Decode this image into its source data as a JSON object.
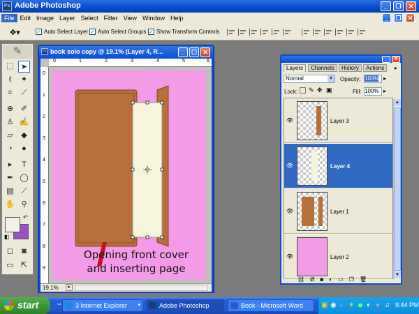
{
  "app": {
    "title": "Adobe Photoshop",
    "logo_text": "Ps",
    "window_controls": [
      "minimize-icon",
      "restore-icon",
      "close-icon"
    ]
  },
  "menu": [
    "File",
    "Edit",
    "Image",
    "Layer",
    "Select",
    "Filter",
    "View",
    "Window",
    "Help"
  ],
  "options": {
    "tool_icon": "move-tool-icon",
    "auto_select_layer": "Auto Select Layer",
    "auto_select_groups": "Auto Select Groups",
    "show_transform_controls": "Show Transform Controls"
  },
  "document": {
    "title": "book solo copy @ 19.1% (Layer 4, R...",
    "zoom": "19.1%",
    "canvas_text_line1": "Opening front cover",
    "canvas_text_line2": "and inserting page",
    "ruler_h": [
      "0",
      "1",
      "2",
      "3",
      "4",
      "5",
      "6"
    ],
    "ruler_v": [
      "0",
      "1",
      "2",
      "3",
      "4",
      "5",
      "6",
      "7",
      "8",
      "9"
    ]
  },
  "layers_panel": {
    "tabs": [
      "Layers",
      "Channels",
      "History",
      "Actions"
    ],
    "blend_mode": "Normal",
    "opacity_label": "Opacity:",
    "opacity_value": "100%",
    "lock_label": "Lock:",
    "fill_label": "Fill:",
    "fill_value": "100%",
    "layers": [
      {
        "name": "Layer 3",
        "selected": false
      },
      {
        "name": "Layer 4",
        "selected": true
      },
      {
        "name": "Layer 1",
        "selected": false
      },
      {
        "name": "Layer 2",
        "selected": false
      }
    ]
  },
  "taskbar": {
    "start": "start",
    "items": [
      {
        "label": "3 Internet Explorer",
        "active": false,
        "color": "#1e88e5"
      },
      {
        "label": "Adobe Photoshop",
        "active": true,
        "color": "#1c3c7c"
      },
      {
        "label": "Book - Microsoft Word",
        "active": false,
        "color": "#2b5fbf"
      }
    ],
    "clock": "9:44 PM"
  },
  "colors": {
    "canvas_background": "#f49be8",
    "book_cover": "#b86f3a",
    "inserted_page": "#f5f5dc",
    "selection_blue": "#316ac5",
    "foreground_swatch": "#f4f2e8",
    "background_swatch": "#9a4ec8"
  }
}
